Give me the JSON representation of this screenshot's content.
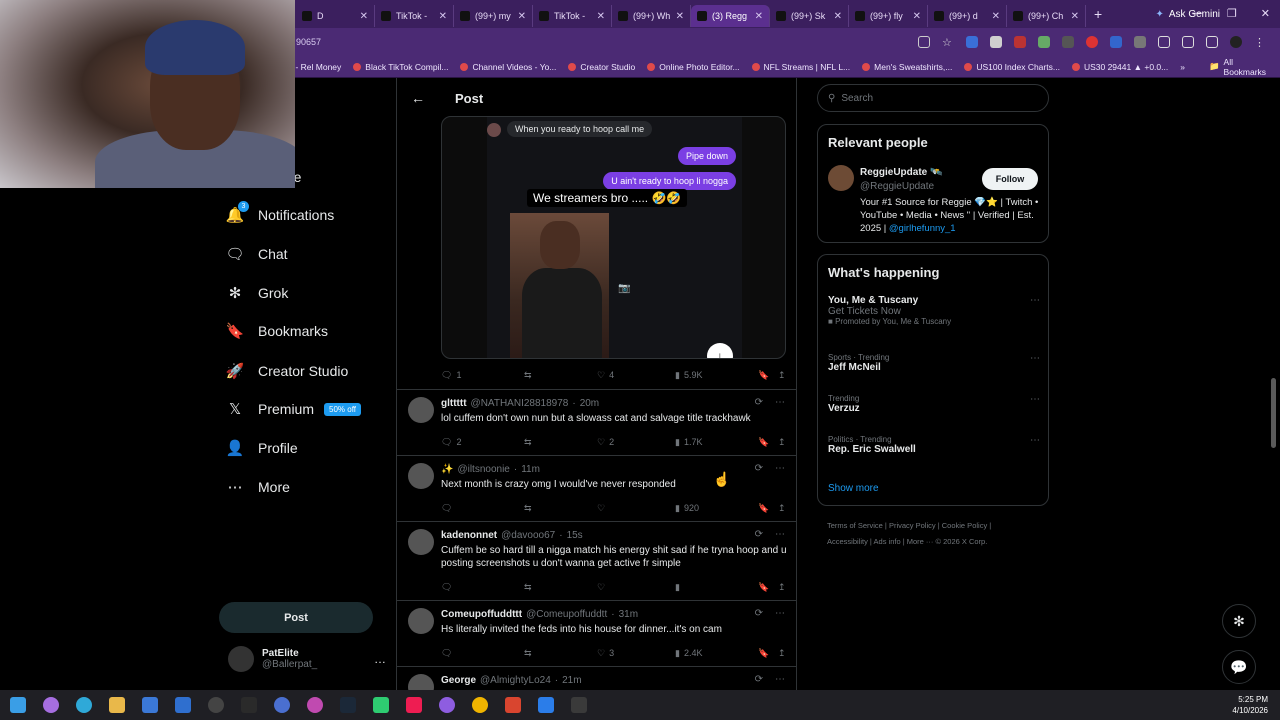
{
  "browser": {
    "tabs": [
      {
        "label": "D",
        "active": false
      },
      {
        "label": "TikTok - ",
        "active": false
      },
      {
        "label": "(99+) my",
        "active": false
      },
      {
        "label": "TikTok - ",
        "active": false
      },
      {
        "label": "(99+) Wh",
        "active": false
      },
      {
        "label": "(3) Regg",
        "active": true
      },
      {
        "label": "(99+) Sk",
        "active": false
      },
      {
        "label": "(99+) fly",
        "active": false
      },
      {
        "label": "(99+) d",
        "active": false
      },
      {
        "label": "(99+) Ch",
        "active": false
      }
    ],
    "ask_gemini": "Ask Gemini",
    "url": "90657",
    "bookmarks": [
      "Jp - Rel Money",
      "Black TikTok Compil...",
      "Channel Videos - Yo...",
      "Creator Studio",
      "Online Photo Editor...",
      "NFL Streams | NFL L...",
      "Men's Sweatshirts,...",
      "US100 Index Charts...",
      "US30 29441 ▲ +0.0..."
    ],
    "all_bookmarks": "All Bookmarks"
  },
  "sidebar": {
    "partial_item": "re",
    "items": [
      {
        "label": "Notifications",
        "icon": "bell-icon",
        "badge": "3"
      },
      {
        "label": "Chat",
        "icon": "chat-icon"
      },
      {
        "label": "Grok",
        "icon": "grok-icon"
      },
      {
        "label": "Bookmarks",
        "icon": "bookmark-icon"
      },
      {
        "label": "Creator Studio",
        "icon": "rocket-icon"
      },
      {
        "label": "Premium",
        "icon": "x-logo-icon",
        "pill": "50% off"
      },
      {
        "label": "Profile",
        "icon": "person-icon"
      },
      {
        "label": "More",
        "icon": "more-circle-icon"
      }
    ],
    "post_button": "Post",
    "account": {
      "name": "PatElite",
      "handle": "@Ballerpat_",
      "more": "…"
    }
  },
  "main": {
    "header_title": "Post",
    "media": {
      "bubble_in": "When you ready to hoop call me",
      "bubble_out_1": "Pipe down",
      "bubble_out_2": "U ain't ready to hoop li nogga",
      "caption": "We streamers bro ..... 🤣🤣"
    },
    "post_stats": {
      "replies": "1",
      "retweets": "",
      "likes": "4",
      "views": "5.9K"
    },
    "replies": [
      {
        "name": "glttttt",
        "handle": "@NATHANI28818978",
        "time": "20m",
        "text": "lol cuffem don't own nun but a slowass cat and salvage title trackhawk",
        "replies": "2",
        "retweets": "",
        "likes": "2",
        "views": "1.7K"
      },
      {
        "name": "✨",
        "handle": "@iltsnoonie",
        "time": "11m",
        "text": "Next month is crazy omg I would've never responded",
        "replies": "",
        "retweets": "",
        "likes": "",
        "views": "920"
      },
      {
        "name": "kadenonnet",
        "handle": "@davooo67",
        "time": "15s",
        "text": "Cuffem be so hard till a nigga match his energy shit sad if he tryna hoop and u posting screenshots u don't wanna get active fr simple",
        "replies": "",
        "retweets": "",
        "likes": "",
        "views": ""
      },
      {
        "name": "Comeupoffuddttt",
        "handle": "@Comeupoffuddtt",
        "time": "31m",
        "text": "Hs literally invited the feds into his house for dinner...it's on cam",
        "replies": "",
        "retweets": "",
        "likes": "3",
        "views": "2.4K"
      },
      {
        "name": "George",
        "handle": "@AlmightyLo24",
        "time": "21m",
        "text": "",
        "replies": "",
        "retweets": "",
        "likes": "",
        "views": ""
      }
    ]
  },
  "right": {
    "search_placeholder": "Search",
    "relevant_title": "Relevant people",
    "relevant": {
      "name": "ReggieUpdate 🛰️",
      "handle": "@ReggieUpdate",
      "follow": "Follow",
      "bio": "Your #1 Source for Reggie 💎⭐ | Twitch • YouTube • Media • News \" | Verified | Est. 2025 |",
      "bio_link": "@girlhefunny_1"
    },
    "happening_title": "What's happening",
    "trends": [
      {
        "meta": "",
        "name": "You, Me & Tuscany",
        "sub": "Get Tickets Now",
        "promo": "Promoted by You, Me & Tuscany"
      },
      {
        "meta": "Sports · Trending",
        "name": "Jeff McNeil",
        "sub": "",
        "promo": ""
      },
      {
        "meta": "Trending",
        "name": "Verzuz",
        "sub": "",
        "promo": ""
      },
      {
        "meta": "Politics · Trending",
        "name": "Rep. Eric Swalwell",
        "sub": "",
        "promo": ""
      }
    ],
    "show_more": "Show more",
    "footer_line1": "Terms of Service  |  Privacy Policy  |  Cookie Policy  |",
    "footer_line2": "Accessibility  |  Ads info  |  More ···  © 2026 X Corp."
  },
  "taskbar": {
    "time": "5:25 PM",
    "date": "4/10/2026"
  }
}
